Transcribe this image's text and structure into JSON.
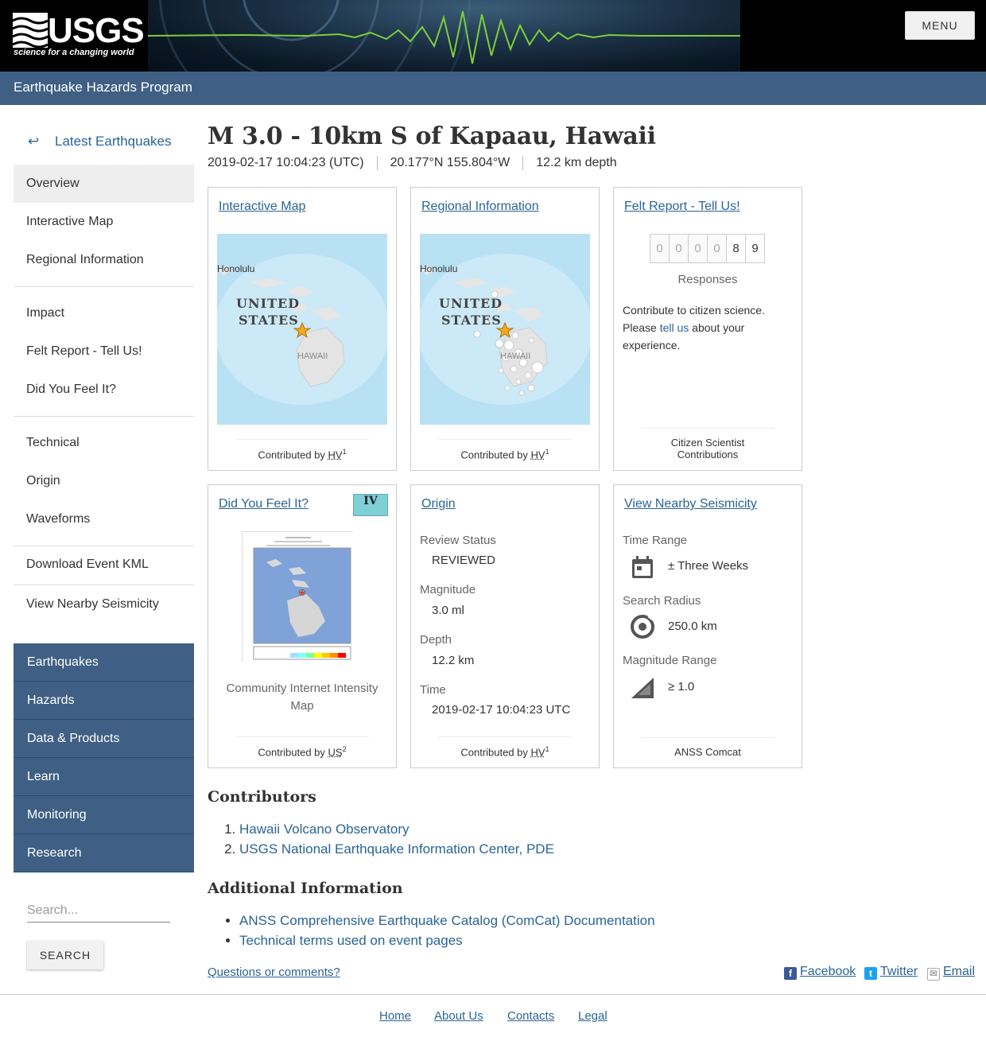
{
  "header": {
    "logo_word": "USGS",
    "logo_tagline": "science for a changing world",
    "menu_label": "MENU",
    "program": "Earthquake Hazards Program"
  },
  "sidebar": {
    "back_label": "Latest Earthquakes",
    "groups": [
      [
        "Overview",
        "Interactive Map",
        "Regional Information"
      ],
      [
        "Impact",
        "Felt Report - Tell Us!",
        "Did You Feel It?"
      ],
      [
        "Technical",
        "Origin",
        "Waveforms"
      ],
      [
        "Download Event KML"
      ],
      [
        "View Nearby Seismicity"
      ]
    ],
    "nav": [
      "Earthquakes",
      "Hazards",
      "Data & Products",
      "Learn",
      "Monitoring",
      "Research"
    ],
    "search_placeholder": "Search...",
    "search_button": "SEARCH"
  },
  "event": {
    "title": "M 3.0 - 10km S of Kapaau, Hawaii",
    "time": "2019-02-17 10:04:23 (UTC)",
    "location": "20.177°N 155.804°W",
    "depth": "12.2 km depth"
  },
  "cards": {
    "interactive_map": {
      "title": "Interactive Map",
      "contributed_by": "Contributed by",
      "contributor": "HV",
      "sup": "1",
      "labels": [
        "Honolulu",
        "UNITED",
        "STATES",
        "HAWAII"
      ]
    },
    "regional": {
      "title": "Regional Information",
      "contributed_by": "Contributed by",
      "contributor": "HV",
      "sup": "1",
      "labels": [
        "Honolulu",
        "UNITED",
        "STATES",
        "HAWAII"
      ]
    },
    "felt": {
      "title": "Felt Report - Tell Us!",
      "digits": [
        "0",
        "0",
        "0",
        "0",
        "8",
        "9"
      ],
      "responses": "Responses",
      "text_before": "Contribute to citizen science. Please ",
      "link": "tell us",
      "text_after": " about your experience.",
      "footer": "Citizen Scientist Contributions"
    },
    "dyfi": {
      "title": "Did You Feel It?",
      "intensity": "IV",
      "caption": "Community Internet Intensity Map",
      "contributed_by": "Contributed by",
      "contributor": "US",
      "sup": "2"
    },
    "origin": {
      "title": "Origin",
      "review_label": "Review Status",
      "review_value": "REVIEWED",
      "magnitude_label": "Magnitude",
      "magnitude_value": "3.0 ml",
      "depth_label": "Depth",
      "depth_value": "12.2 km",
      "time_label": "Time",
      "time_value": "2019-02-17 10:04:23 UTC",
      "contributed_by": "Contributed by",
      "contributor": "HV",
      "sup": "1"
    },
    "seismicity": {
      "title": "View Nearby Seismicity",
      "time_label": "Time Range",
      "time_value": "± Three Weeks",
      "radius_label": "Search Radius",
      "radius_value": "250.0 km",
      "mag_label": "Magnitude Range",
      "mag_value": "≥ 1.0",
      "footer": "ANSS Comcat"
    }
  },
  "contributors": {
    "title": "Contributors",
    "items": [
      "Hawaii Volcano Observatory",
      "USGS National Earthquake Information Center, PDE"
    ]
  },
  "additional": {
    "title": "Additional Information",
    "items": [
      "ANSS Comprehensive Earthquake Catalog (ComCat) Documentation",
      "Technical terms used on event pages"
    ]
  },
  "footer": {
    "questions": "Questions or comments?",
    "social": [
      "Facebook",
      "Twitter",
      "Email"
    ],
    "links": [
      "Home",
      "About Us",
      "Contacts",
      "Legal"
    ]
  },
  "colors": {
    "program_bar": "#3f6084",
    "link": "#2a6496",
    "intensity_iv": "#7ecfd6",
    "epicenter_star": "#f5a623"
  }
}
